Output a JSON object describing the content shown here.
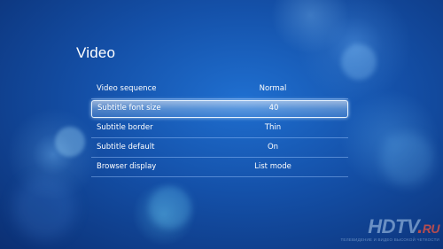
{
  "screen": {
    "title": "Video"
  },
  "menu": {
    "items": [
      {
        "label": "Video sequence",
        "value": "Normal",
        "selected": false
      },
      {
        "label": "Subtitle font size",
        "value": "40",
        "selected": true
      },
      {
        "label": "Subtitle border",
        "value": "Thin",
        "selected": false
      },
      {
        "label": "Subtitle default",
        "value": "On",
        "selected": false
      },
      {
        "label": "Browser display",
        "value": "List mode",
        "selected": false
      }
    ]
  },
  "watermark": {
    "logo_main": "HDTV",
    "logo_dot": ".",
    "logo_suffix": "RU",
    "tagline": "ТЕЛЕВИДЕНИЕ И ВИДЕО ВЫСОКОЙ ЧЕТКОСТИ"
  },
  "colors": {
    "background": "#1450a8",
    "highlight_border": "#ebf5ff",
    "text": "#ffffff"
  }
}
